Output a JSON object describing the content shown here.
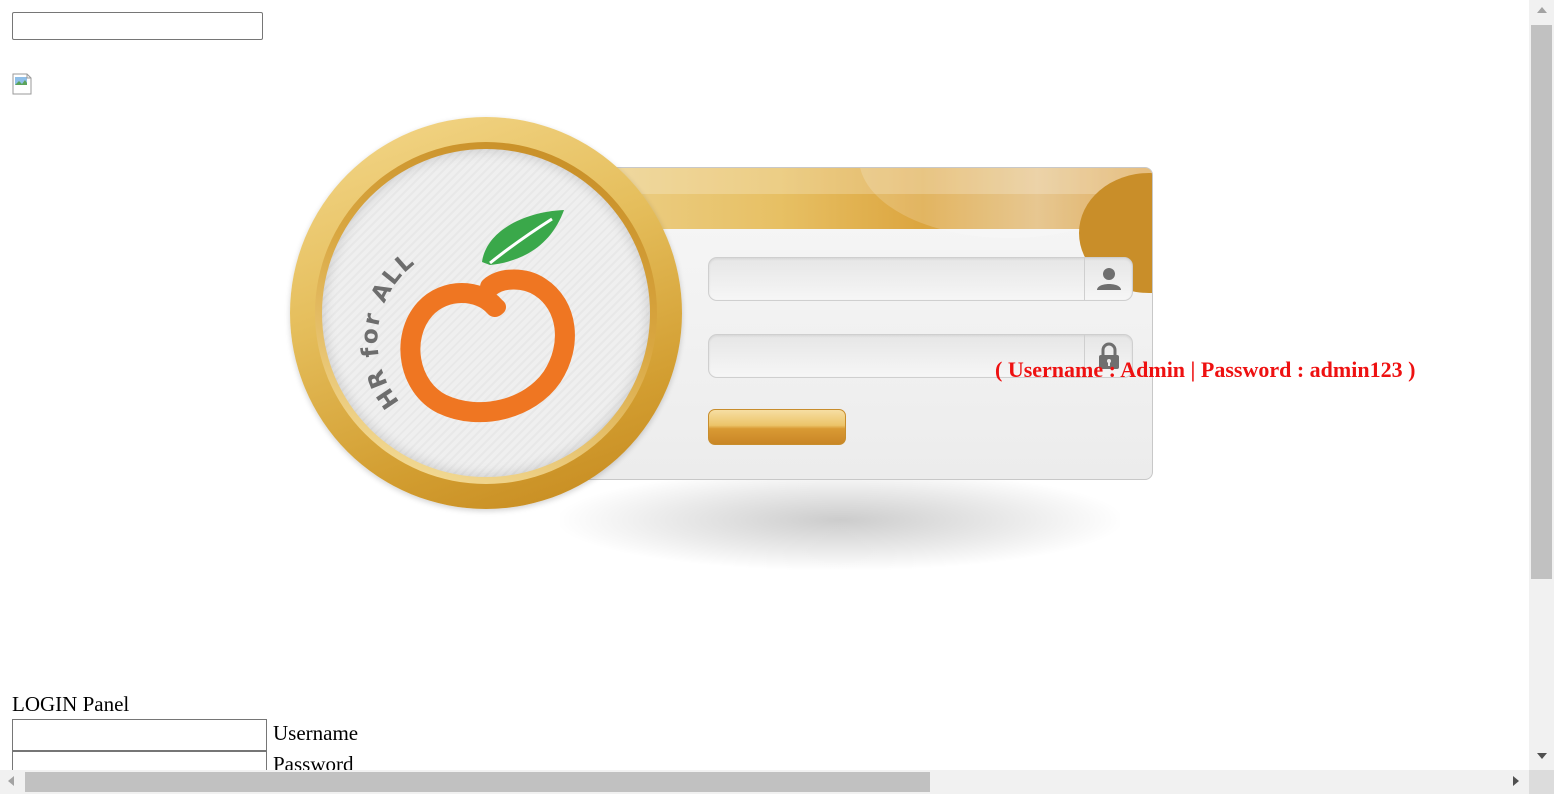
{
  "page": {
    "top_input": {
      "value": "",
      "placeholder": ""
    },
    "broken_image_alt": ""
  },
  "login_visual": {
    "logo_text": "HR for ALL",
    "username_field": {
      "value": "",
      "placeholder": ""
    },
    "password_field": {
      "value": "",
      "placeholder": ""
    },
    "login_button_label": "",
    "icons": {
      "username": "user-icon",
      "password": "lock-icon"
    },
    "credentials_hint": "( Username : Admin | Password : admin123 )"
  },
  "form": {
    "title": "LOGIN Panel",
    "username_label": "Username",
    "password_label": "Password",
    "username": {
      "value": "",
      "placeholder": ""
    },
    "password": {
      "value": "",
      "placeholder": ""
    }
  },
  "colors": {
    "hint_red": "#ee1111",
    "gold": "#d9a23a",
    "orange": "#ef7622",
    "leaf_green": "#3aa84a"
  }
}
